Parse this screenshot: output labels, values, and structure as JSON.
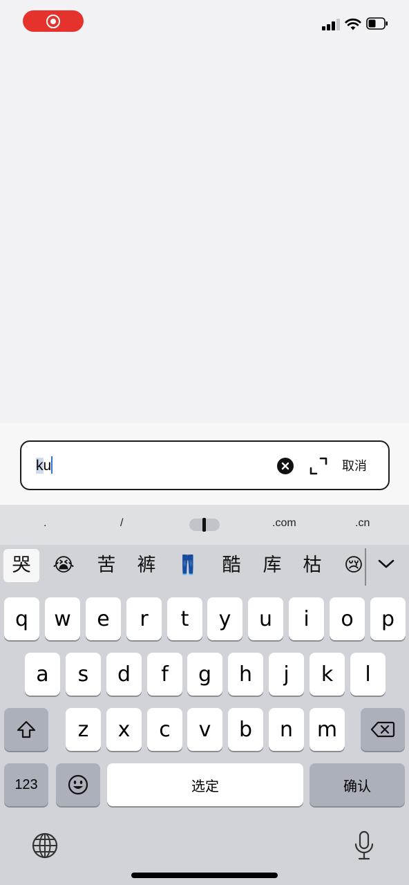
{
  "status_bar": {
    "recording_indicator": "record-icon",
    "icons": [
      "signal-icon",
      "wifi-icon",
      "battery-icon"
    ]
  },
  "search": {
    "query_highlight": "k",
    "query_rest": "u",
    "clear_icon": "clear-icon",
    "expand_icon": "expand-icon",
    "cancel_label": "取消"
  },
  "quick_bar": {
    "items": [
      ".",
      "/",
      ".com",
      ".cn"
    ]
  },
  "keyboard": {
    "candidates": [
      "哭",
      "😭",
      "苦",
      "裤",
      "👖",
      "酷",
      "库",
      "枯",
      "😢"
    ],
    "row1": [
      "q",
      "w",
      "e",
      "r",
      "t",
      "y",
      "u",
      "i",
      "o",
      "p"
    ],
    "row2": [
      "a",
      "s",
      "d",
      "f",
      "g",
      "h",
      "j",
      "k",
      "l"
    ],
    "row3": [
      "z",
      "x",
      "c",
      "v",
      "b",
      "n",
      "m"
    ],
    "shift_icon": "shift-icon",
    "delete_icon": "delete-icon",
    "numbers_label": "123",
    "emoji_icon": "emoji-icon",
    "space_label": "选定",
    "confirm_label": "确认",
    "globe_icon": "globe-icon",
    "mic_icon": "microphone-icon"
  },
  "colors": {
    "record_pill": "#e5322d",
    "caret": "#2f6fe3",
    "highlight": "#cfd9ee",
    "keyboard_bg": "#d1d3d9",
    "dark_key": "#abb0ba"
  }
}
